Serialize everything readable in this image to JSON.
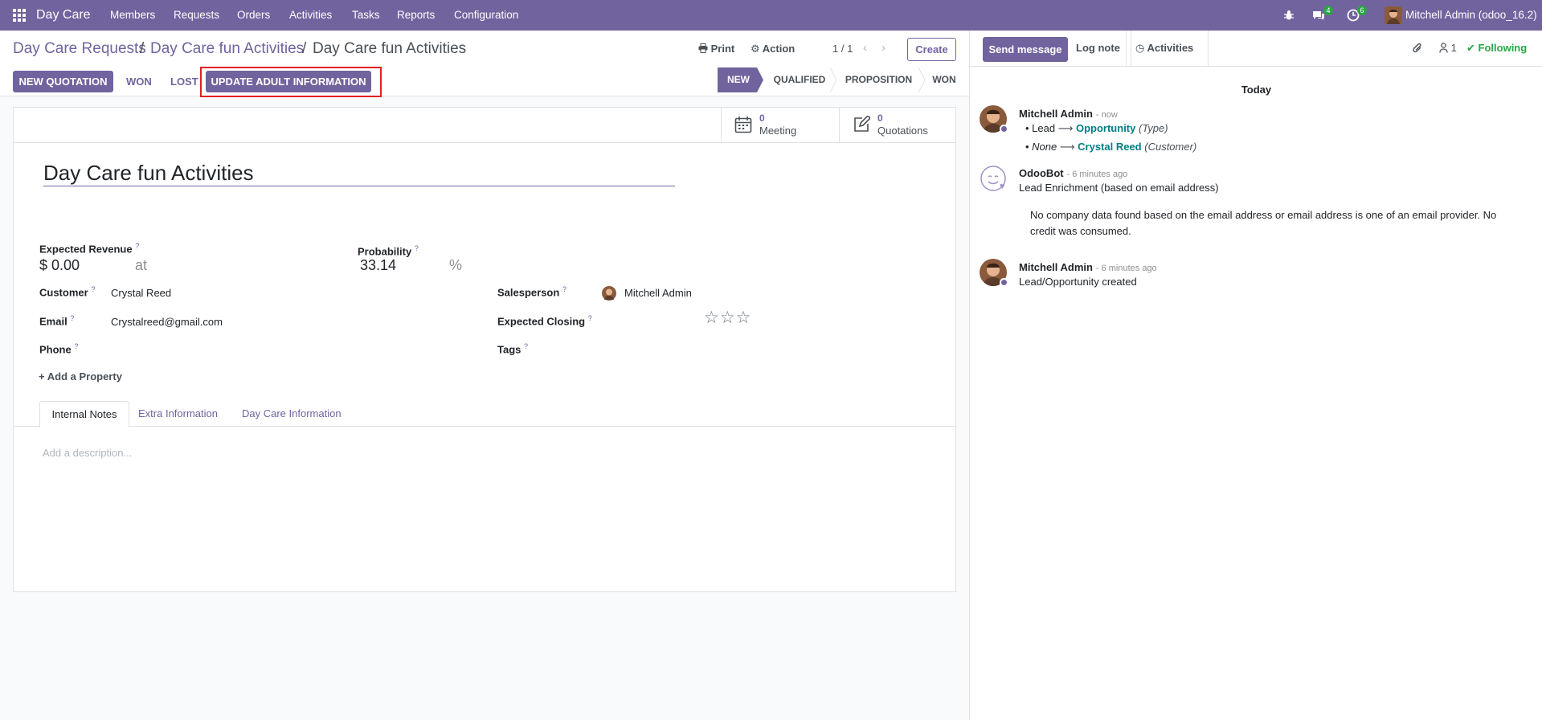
{
  "navbar": {
    "app_name": "Day Care",
    "menus": [
      "Members",
      "Requests",
      "Orders",
      "Activities",
      "Tasks",
      "Reports",
      "Configuration"
    ],
    "messages_count": "4",
    "activities_count": "6",
    "user": "Mitchell Admin (odoo_16.2)"
  },
  "breadcrumb": {
    "level1": "Day Care Requests",
    "level2": "Day Care fun Activities",
    "current": "Day Care fun Activities",
    "separator": "/"
  },
  "control": {
    "print": "Print",
    "action": "Action",
    "pager": "1 / 1",
    "create": "Create"
  },
  "status_buttons": {
    "new_quotation": "NEW QUOTATION",
    "won": "WON",
    "lost": "LOST",
    "update_adult": "UPDATE ADULT INFORMATION"
  },
  "stages": [
    "NEW",
    "QUALIFIED",
    "PROPOSITION",
    "WON"
  ],
  "active_stage": "NEW",
  "smart_buttons": {
    "meeting_count": "0",
    "meeting_label": "Meeting",
    "quotations_count": "0",
    "quotations_label": "Quotations"
  },
  "form": {
    "title": "Day Care fun Activities",
    "expected_revenue_label": "Expected Revenue",
    "expected_revenue": "$ 0.00",
    "at": "at",
    "probability_label": "Probability",
    "probability": "33.14",
    "percent": "%",
    "customer_label": "Customer",
    "customer": "Crystal Reed",
    "email_label": "Email",
    "email": "Crystalreed@gmail.com",
    "phone_label": "Phone",
    "phone": "",
    "salesperson_label": "Salesperson",
    "salesperson": "Mitchell Admin",
    "expected_closing_label": "Expected Closing",
    "tags_label": "Tags",
    "help_mark": "?",
    "priority_stars": 0,
    "add_property": "Add a Property"
  },
  "tabs": [
    "Internal Notes",
    "Extra Information",
    "Day Care Information"
  ],
  "active_tab": "Internal Notes",
  "notes_placeholder": "Add a description...",
  "chatter": {
    "send_message": "Send message",
    "log_note": "Log note",
    "activities": "Activities",
    "followers_count": "1",
    "following": "Following",
    "date_separator": "Today",
    "messages": [
      {
        "author": "Mitchell Admin",
        "time": "- now",
        "changes": [
          {
            "old": "Lead",
            "arrow": "⟶",
            "new": "Opportunity",
            "field": "(Type)"
          },
          {
            "old": "None",
            "arrow": "⟶",
            "new": "Crystal Reed",
            "field": "(Customer)"
          }
        ]
      },
      {
        "author": "OdooBot",
        "time": "- 6 minutes ago",
        "line1": "Lead Enrichment (based on email address)",
        "line2": "No company data found based on the email address or email address is one of an email provider. No",
        "line3": "credit was consumed."
      },
      {
        "author": "Mitchell Admin",
        "time": "- 6 minutes ago",
        "body": "Lead/Opportunity created"
      }
    ]
  },
  "colors": {
    "brand": "#71639e",
    "link": "#017e84",
    "following": "#28a745",
    "highlight_border": "#e02020"
  }
}
